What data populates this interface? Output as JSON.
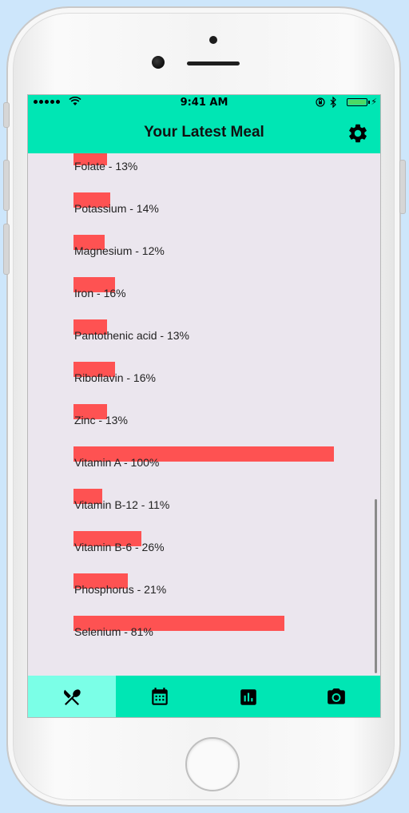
{
  "status_bar": {
    "time": "9:41 AM"
  },
  "header": {
    "title": "Your Latest Meal",
    "settings_icon": "gear-icon"
  },
  "nutrients": [
    {
      "label": "Folate - 13%",
      "percent": 13
    },
    {
      "label": "Potassium - 14%",
      "percent": 14
    },
    {
      "label": "Magnesium - 12%",
      "percent": 12
    },
    {
      "label": "Iron - 16%",
      "percent": 16
    },
    {
      "label": "Pantothenic acid - 13%",
      "percent": 13
    },
    {
      "label": "Riboflavin - 16%",
      "percent": 16
    },
    {
      "label": "Zinc - 13%",
      "percent": 13
    },
    {
      "label": "Vitamin A - 100%",
      "percent": 100
    },
    {
      "label": "Vitamin B-12 - 11%",
      "percent": 11
    },
    {
      "label": "Vitamin B-6 - 26%",
      "percent": 26
    },
    {
      "label": "Phosphorus - 21%",
      "percent": 21
    },
    {
      "label": "Selenium - 81%",
      "percent": 81
    }
  ],
  "tabs": [
    {
      "icon": "fork-knife-icon",
      "active": true
    },
    {
      "icon": "calendar-icon",
      "active": false
    },
    {
      "icon": "bar-chart-icon",
      "active": false
    },
    {
      "icon": "camera-icon",
      "active": false
    }
  ],
  "colors": {
    "accent": "#00e6b4",
    "active_tab": "#7bffe7",
    "bar": "#fe5252",
    "background": "#ebe6ee"
  }
}
